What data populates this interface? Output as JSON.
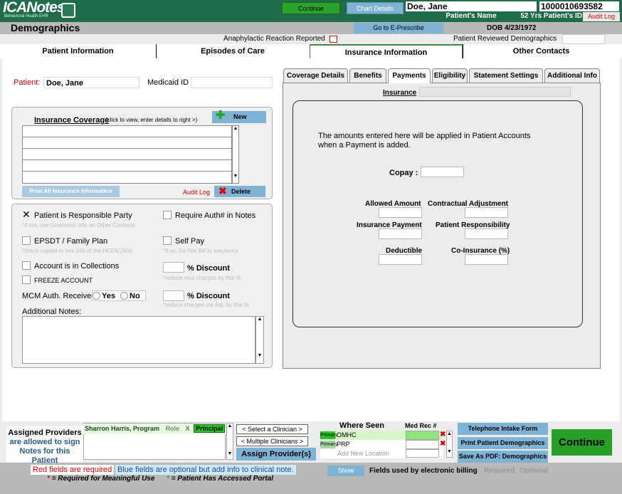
{
  "app": {
    "logo_text": "ICANotes",
    "logo_sub": "Behavioral Health EHR"
  },
  "header": {
    "continue_label": "Continue",
    "chart_details_label": "Chart Details",
    "patient_name": "Doe, Jane",
    "patient_name_label": "Patient's Name",
    "patient_id": "1000010693582",
    "patient_id_label": "52 Yrs Patient's ID",
    "audit_log_label": "Audit Log",
    "page_title": "Demographics",
    "eprescribe_label": "Go to E-Prescribe",
    "dob": "DOB 4/23/1972",
    "anaphylactic_label": "Anaphylactic Reaction Reported",
    "reviewed_label": "Patient Reviewed Demographics"
  },
  "main_tabs": [
    "Patient Information",
    "Episodes of Care",
    "Insurance Information",
    "Other Contacts"
  ],
  "patient_row": {
    "patient_label": "Patient:",
    "patient_value": "Doe, Jane",
    "medicaid_label": "Medicaid ID",
    "medicaid_value": ""
  },
  "coverage": {
    "title": "Insurance Coverage",
    "subtitle": "(click to view, enter details to right >)",
    "new_label": "New",
    "print_label": "Print All Insurance Information",
    "audit_label": "Audit Log",
    "delete_label": "Delete"
  },
  "options": {
    "responsible": "Patient is Responsible Party",
    "responsible_hint": "*if not, use Guarantor Info on Other Contacts",
    "require_auth": "Require Auth# in Notes",
    "epsdt": "EPSDT / Family Plan",
    "epsdt_hint": "*this is copied to box 24h of the HCFA/1500",
    "self_pay": "Self Pay",
    "self_pay_hint": "*if so, Do Not Bill to Insurance",
    "collections": "Account is in Collections",
    "discount1": "% Discount",
    "discount1_hint": "*reduce new charges by this %",
    "freeze": "FREEZE ACCOUNT",
    "mcm_label": "MCM Auth. Received",
    "yes": "Yes",
    "no": "No",
    "discount2": "% Discount",
    "discount2_hint": "*reduce charges via Adj. by this %",
    "notes_label": "Additional Notes:"
  },
  "sub_tabs": [
    "Coverage Details",
    "Benefits",
    "Payments",
    "Eligibility",
    "Statement Settings",
    "Additional Info"
  ],
  "payments": {
    "insurance_label": "Insurance",
    "info_text": "The amounts entered here will be applied in Patient Accounts when a Payment is added.",
    "copay": "Copay :",
    "allowed": "Allowed Amount",
    "contractual": "Contractual Adjustment",
    "ins_payment": "Insurance Payment",
    "pt_resp": "Patient Responsibility",
    "deductible": "Deductible",
    "coins": "Co-Insurance (%)"
  },
  "providers": {
    "title_line1": "Assigned Providers",
    "title_line2": "are allowed to sign",
    "title_line3": "Notes for this Patient",
    "row_name": "Sharron Harris, Program",
    "row_role": "Role",
    "row_x": "X",
    "row_principal": "Principal",
    "select_clinician": "< Select a Clinician >",
    "multiple_clinicians": "< Multiple Clinicians >",
    "assign_label": "Assign Provider(s)"
  },
  "where_seen": {
    "title": "Where Seen",
    "medrec_title": "Med Rec #",
    "rows": [
      {
        "tag": "Primary",
        "name": "OMHC"
      },
      {
        "tag": "Primary",
        "name": "PRP"
      }
    ],
    "add_new": "Add New Location"
  },
  "footer_buttons": {
    "telephone": "Telephone Intake Form",
    "print_demo": "Print Patient Demographics",
    "save_pdf": "Save As PDF: Demographics",
    "continue": "Continue"
  },
  "legend": {
    "red": "Red fields are required",
    "blue": "Blue fields are optional but add info to clinical note.",
    "required_mu": "= Required for Meaningful Use",
    "portal": "= Patient Has Accessed Portal",
    "show": "Show",
    "fields_billing": "Fields used by electronic billing",
    "required": "Required",
    "optional": "Optional"
  }
}
